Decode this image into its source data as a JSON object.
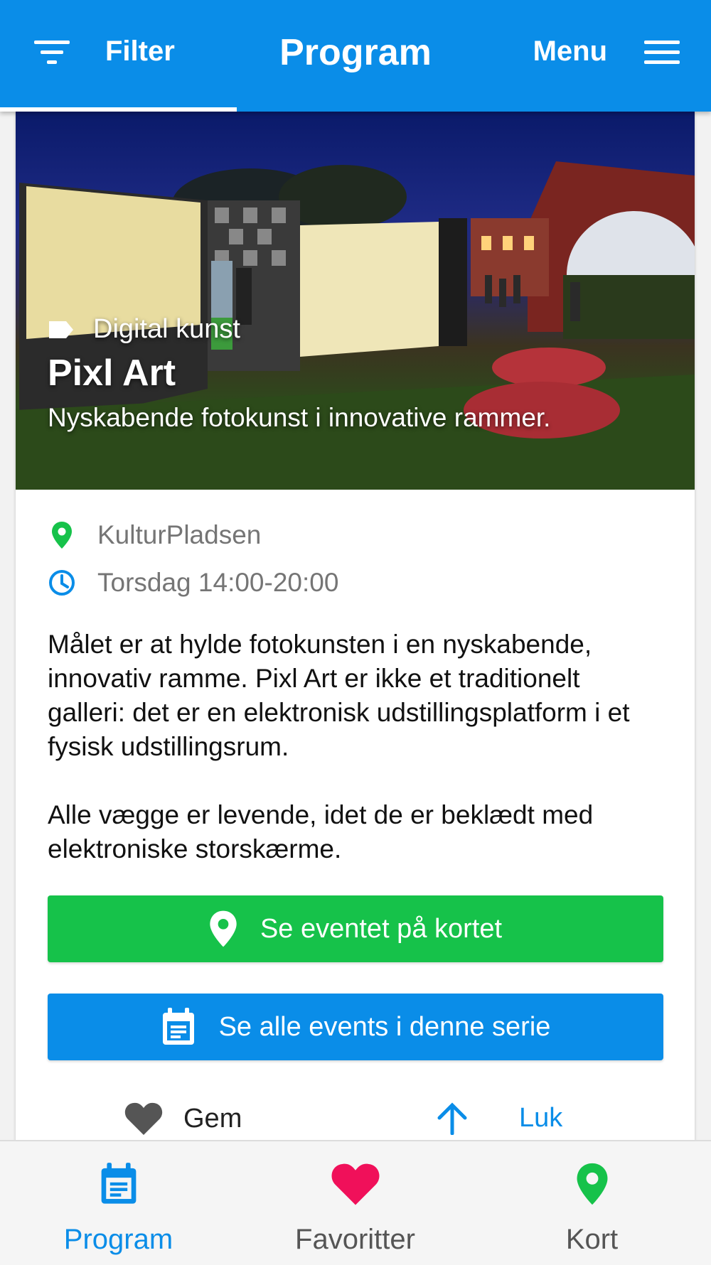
{
  "appbar": {
    "filter_label": "Filter",
    "title": "Program",
    "menu_label": "Menu"
  },
  "event": {
    "category": "Digital kunst",
    "title": "Pixl Art",
    "subtitle": "Nyskabende fotokunst i innovative rammer.",
    "location": "KulturPladsen",
    "time": "Torsdag 14:00-20:00",
    "description": [
      "Målet er at hylde fotokunsten i en nyskabende, innovativ ramme. Pixl Art er ikke et traditionelt galleri: det er en elektronisk udstillingsplatform i et fysisk udstillingsrum.",
      "Alle vægge er levende, idet de er beklædt med elektroniske storskærme."
    ]
  },
  "buttons": {
    "map_label": "Se eventet på kortet",
    "series_label": "Se alle events i denne serie",
    "save_label": "Gem",
    "close_label": "Luk"
  },
  "bottom_nav": {
    "items": [
      {
        "label": "Program",
        "icon": "calendar-icon",
        "active": true
      },
      {
        "label": "Favoritter",
        "icon": "heart-icon",
        "active": false
      },
      {
        "label": "Kort",
        "icon": "map-pin-icon",
        "active": false
      }
    ]
  },
  "colors": {
    "primary": "#0a8de8",
    "green": "#16c24a",
    "favorite": "#f0105a"
  }
}
